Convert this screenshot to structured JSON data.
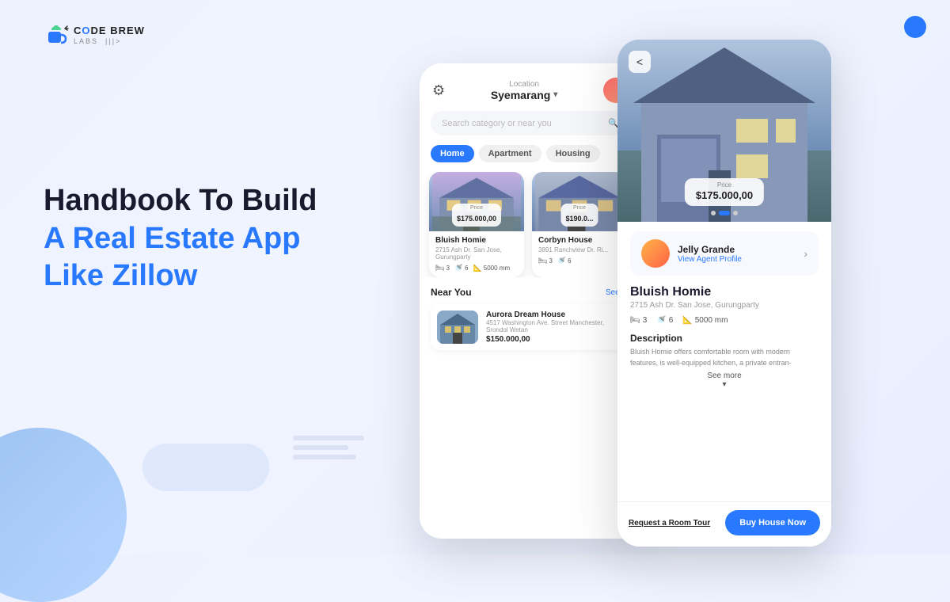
{
  "logo": {
    "brand1": "CODE",
    "brand2": "BREW",
    "sub": "LABS",
    "tagline": "|||>"
  },
  "headline": {
    "line1": "Handbook To Build",
    "line2_blue": "A Real Estate App",
    "line3_blue": "Like Zillow"
  },
  "phone_middle": {
    "location_label": "Location",
    "location_name": "Syemarang",
    "search_placeholder": "Search category or near you",
    "tabs": [
      "Home",
      "Apartment",
      "Housing"
    ],
    "cards": [
      {
        "name": "Bluish Homie",
        "address": "2715 Ash Dr. San Jose, Gurungparty",
        "price_label": "Price",
        "price": "$175.000,00",
        "beds": "3",
        "baths": "6",
        "area": "5000 mm"
      },
      {
        "name": "Corbyn House",
        "address": "3891 Ranchview Dr. Ri...",
        "price_label": "Price",
        "price": "$190.0...",
        "beds": "3",
        "baths": "6",
        "area": ""
      }
    ],
    "nearby_title": "Near You",
    "see_all": "See All",
    "nearby_item": {
      "name": "Aurora Dream House",
      "address": "4517 Washington Ave. Street Manchester, Srondol Wetan",
      "price": "$150.000,00"
    }
  },
  "phone_right": {
    "back_label": "<",
    "price_label": "Price",
    "price": "$175.000,00",
    "agent_name": "Jelly Grande",
    "agent_sub": "View Agent Profile",
    "property_name": "Bluish Homie",
    "property_address": "2715 Ash Dr. San Jose, Gurungparty",
    "beds": "3",
    "baths": "6",
    "area": "5000 mm",
    "desc_title": "Description",
    "desc_text": "Bluish Homie offers comfortable room with modern features, is well-equipped kitchen, a private entran-",
    "see_more": "See more",
    "btn_tour": "Request a Room Tour",
    "btn_buy": "Buy House Now"
  }
}
